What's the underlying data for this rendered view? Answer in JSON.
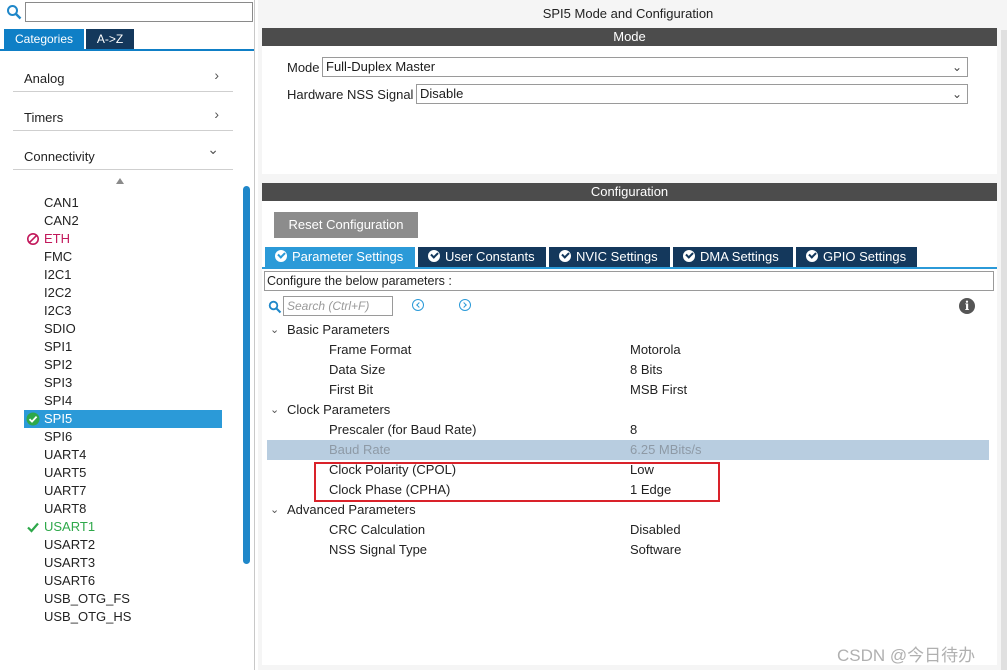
{
  "left": {
    "tabs": {
      "categories": "Categories",
      "az": "A->Z"
    },
    "categories": [
      {
        "label": "Analog",
        "chevron": "›"
      },
      {
        "label": "Timers",
        "chevron": "›"
      },
      {
        "label": "Connectivity",
        "chevron": "⌄"
      }
    ],
    "peripherals": [
      {
        "label": "CAN1",
        "state": "normal"
      },
      {
        "label": "CAN2",
        "state": "normal"
      },
      {
        "label": "ETH",
        "state": "disabled"
      },
      {
        "label": "FMC",
        "state": "normal"
      },
      {
        "label": "I2C1",
        "state": "normal"
      },
      {
        "label": "I2C2",
        "state": "normal"
      },
      {
        "label": "I2C3",
        "state": "normal"
      },
      {
        "label": "SDIO",
        "state": "normal"
      },
      {
        "label": "SPI1",
        "state": "normal"
      },
      {
        "label": "SPI2",
        "state": "normal"
      },
      {
        "label": "SPI3",
        "state": "normal"
      },
      {
        "label": "SPI4",
        "state": "normal"
      },
      {
        "label": "SPI5",
        "state": "selected"
      },
      {
        "label": "SPI6",
        "state": "normal"
      },
      {
        "label": "UART4",
        "state": "normal"
      },
      {
        "label": "UART5",
        "state": "normal"
      },
      {
        "label": "UART7",
        "state": "normal"
      },
      {
        "label": "UART8",
        "state": "normal"
      },
      {
        "label": "USART1",
        "state": "enabled"
      },
      {
        "label": "USART2",
        "state": "normal"
      },
      {
        "label": "USART3",
        "state": "normal"
      },
      {
        "label": "USART6",
        "state": "normal"
      },
      {
        "label": "USB_OTG_FS",
        "state": "normal"
      },
      {
        "label": "USB_OTG_HS",
        "state": "normal"
      }
    ]
  },
  "right": {
    "title": "SPI5 Mode and Configuration",
    "mode_bar": "Mode",
    "mode": {
      "mode_label": "Mode",
      "mode_value": "Full-Duplex Master",
      "nss_label": "Hardware NSS Signal",
      "nss_value": "Disable"
    },
    "config_bar": "Configuration",
    "reset_button": "Reset Configuration",
    "tabs": [
      {
        "label": "Parameter Settings",
        "active": true
      },
      {
        "label": "User Constants",
        "active": false
      },
      {
        "label": "NVIC Settings",
        "active": false
      },
      {
        "label": "DMA Settings",
        "active": false
      },
      {
        "label": "GPIO Settings",
        "active": false
      }
    ],
    "hint": "Configure the below parameters :",
    "search_placeholder": "Search (Ctrl+F)",
    "groups": {
      "basic": {
        "label": "Basic Parameters",
        "params": [
          {
            "name": "Frame Format",
            "value": "Motorola"
          },
          {
            "name": "Data Size",
            "value": "8 Bits"
          },
          {
            "name": "First Bit",
            "value": "MSB First"
          }
        ]
      },
      "clock": {
        "label": "Clock Parameters",
        "params": [
          {
            "name": "Prescaler (for Baud Rate)",
            "value": "8"
          },
          {
            "name": "Baud Rate",
            "value": "6.25 MBits/s"
          },
          {
            "name": "Clock Polarity (CPOL)",
            "value": "Low"
          },
          {
            "name": "Clock Phase (CPHA)",
            "value": "1 Edge"
          }
        ]
      },
      "advanced": {
        "label": "Advanced Parameters",
        "params": [
          {
            "name": "CRC Calculation",
            "value": "Disabled"
          },
          {
            "name": "NSS Signal Type",
            "value": "Software"
          }
        ]
      }
    }
  },
  "watermark": "CSDN @今日待办",
  "colors": {
    "accent": "#2b9ad8",
    "dark_tab": "#14385c",
    "bar": "#4c4c4c",
    "highlight": "#d9222a"
  }
}
